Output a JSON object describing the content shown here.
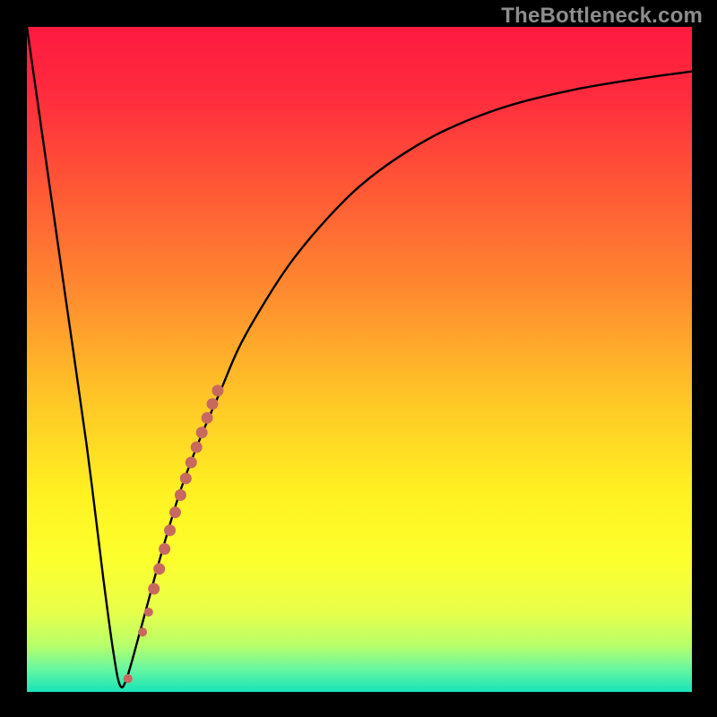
{
  "watermark": "TheBottleneck.com",
  "colors": {
    "frame": "#000000",
    "curve_stroke": "#000000",
    "dot_fill": "#c8695f",
    "gradient_stops": [
      {
        "offset": 0.0,
        "color": "#ff1a3f"
      },
      {
        "offset": 0.1,
        "color": "#ff2b3e"
      },
      {
        "offset": 0.25,
        "color": "#ff5a35"
      },
      {
        "offset": 0.4,
        "color": "#ff8b2f"
      },
      {
        "offset": 0.55,
        "color": "#ffc327"
      },
      {
        "offset": 0.7,
        "color": "#fff121"
      },
      {
        "offset": 0.8,
        "color": "#fdff2d"
      },
      {
        "offset": 0.88,
        "color": "#e7ff4a"
      },
      {
        "offset": 0.93,
        "color": "#b7ff6a"
      },
      {
        "offset": 0.965,
        "color": "#69f79f"
      },
      {
        "offset": 1.0,
        "color": "#18e3b9"
      }
    ]
  },
  "chart_data": {
    "type": "line",
    "title": "",
    "xlabel": "",
    "ylabel": "",
    "xlim": [
      0,
      100
    ],
    "ylim": [
      0,
      100
    ],
    "series": [
      {
        "name": "bottleneck-curve",
        "x": [
          0,
          3,
          6,
          9,
          11.5,
          13,
          14,
          15,
          17,
          20,
          23,
          26,
          29,
          32,
          36,
          40,
          45,
          50,
          56,
          63,
          72,
          82,
          92,
          100
        ],
        "y": [
          100,
          79,
          58,
          37,
          17,
          6,
          1,
          2,
          9,
          20,
          30,
          38,
          45,
          52,
          59,
          65,
          71,
          76,
          80.5,
          84.5,
          88,
          90.5,
          92.2,
          93.3
        ]
      }
    ],
    "highlight_dots": {
      "name": "highlight",
      "points": [
        {
          "x": 15.2,
          "y": 2.0,
          "r": 5
        },
        {
          "x": 17.4,
          "y": 9.0,
          "r": 5
        },
        {
          "x": 18.3,
          "y": 12.0,
          "r": 5
        },
        {
          "x": 19.1,
          "y": 15.5,
          "r": 6.5
        },
        {
          "x": 19.9,
          "y": 18.5,
          "r": 6.5
        },
        {
          "x": 20.7,
          "y": 21.5,
          "r": 6.5
        },
        {
          "x": 21.5,
          "y": 24.3,
          "r": 6.5
        },
        {
          "x": 22.3,
          "y": 27.0,
          "r": 6.5
        },
        {
          "x": 23.1,
          "y": 29.6,
          "r": 6.5
        },
        {
          "x": 23.9,
          "y": 32.1,
          "r": 6.5
        },
        {
          "x": 24.7,
          "y": 34.5,
          "r": 6.5
        },
        {
          "x": 25.5,
          "y": 36.8,
          "r": 6.5
        },
        {
          "x": 26.3,
          "y": 39.0,
          "r": 6.5
        },
        {
          "x": 27.1,
          "y": 41.2,
          "r": 6.5
        },
        {
          "x": 27.9,
          "y": 43.3,
          "r": 6.5
        },
        {
          "x": 28.7,
          "y": 45.3,
          "r": 6.5
        }
      ]
    }
  }
}
